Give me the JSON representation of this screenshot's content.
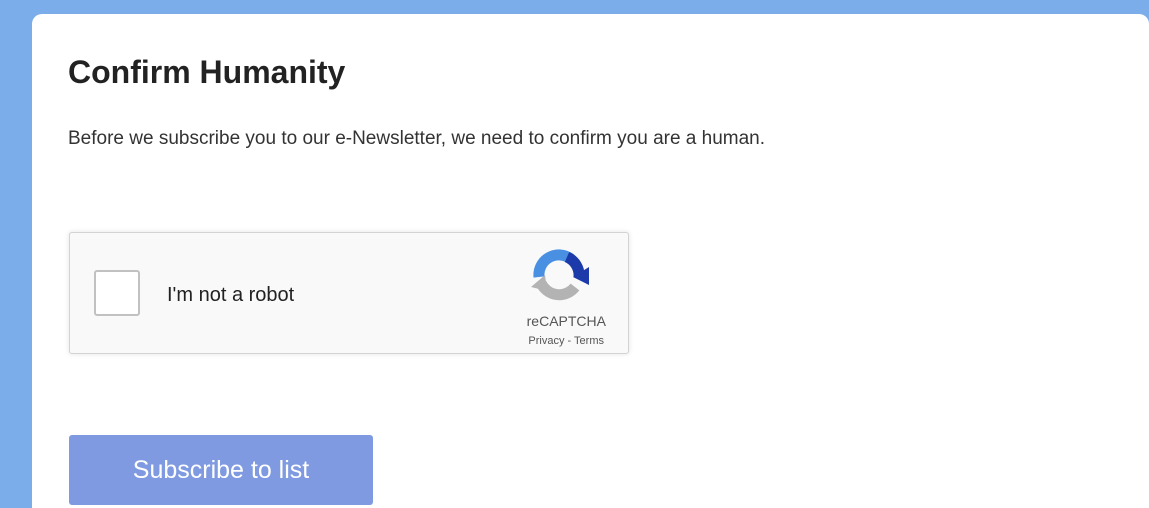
{
  "confirm": {
    "title": "Confirm Humanity",
    "intro": "Before we subscribe you to our e-Newsletter, we need to confirm you are a human."
  },
  "recaptcha": {
    "checkbox_label": "I'm not a robot",
    "brand": "reCAPTCHA",
    "privacy_link": "Privacy",
    "separator": " - ",
    "terms_link": "Terms",
    "checked": false,
    "logo_icon": "recaptcha-logo-icon",
    "colors": {
      "logo_blue": "#1c3aa9",
      "logo_light_blue": "#4a90e2",
      "logo_gray": "#b3b3b3"
    }
  },
  "subscribe": {
    "label": "Subscribe to list",
    "color": "#7f9ae0"
  },
  "background_color": "#7badeb"
}
